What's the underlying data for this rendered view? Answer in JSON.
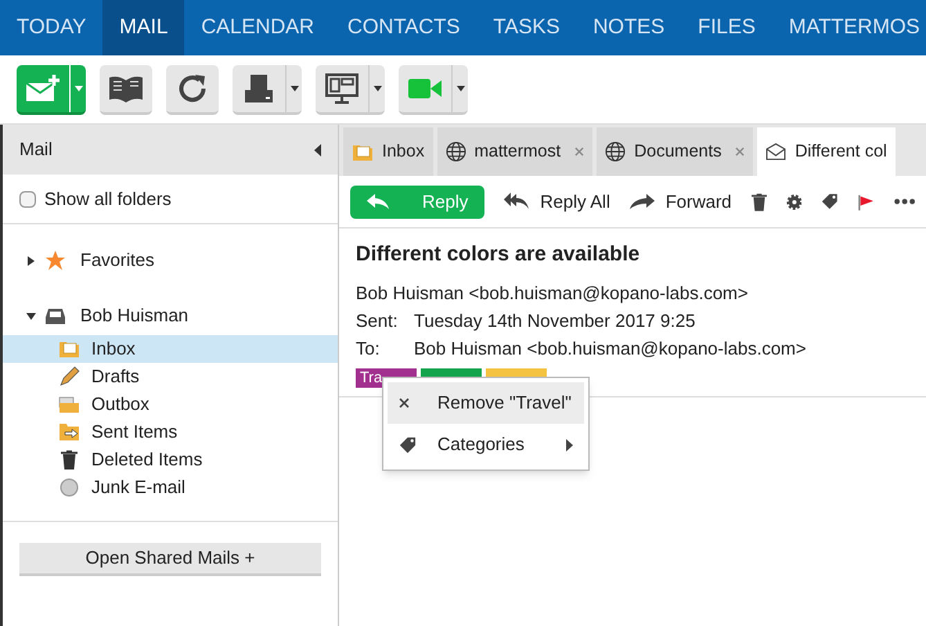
{
  "nav": [
    {
      "label": "TODAY",
      "selected": false
    },
    {
      "label": "MAIL",
      "selected": true
    },
    {
      "label": "CALENDAR",
      "selected": false
    },
    {
      "label": "CONTACTS",
      "selected": false
    },
    {
      "label": "TASKS",
      "selected": false
    },
    {
      "label": "NOTES",
      "selected": false
    },
    {
      "label": "FILES",
      "selected": false
    },
    {
      "label": "MATTERMOS",
      "selected": false
    }
  ],
  "toolbar": [
    {
      "kind": "new-mail",
      "split": true
    },
    {
      "kind": "book",
      "split": false
    },
    {
      "kind": "refresh",
      "split": false
    },
    {
      "kind": "print",
      "split": true
    },
    {
      "kind": "monitor",
      "split": true
    },
    {
      "kind": "video",
      "split": true
    }
  ],
  "sidebar": {
    "title": "Mail",
    "show_all": {
      "label": "Show all folders",
      "checked": false
    },
    "tree": [
      {
        "label": "Favorites",
        "kind": "star",
        "expanded": false
      },
      {
        "label": "Bob Huisman",
        "kind": "store",
        "expanded": true,
        "children": [
          {
            "label": "Inbox",
            "kind": "inbox",
            "selected": true
          },
          {
            "label": "Drafts",
            "kind": "drafts",
            "selected": false
          },
          {
            "label": "Outbox",
            "kind": "outbox",
            "selected": false
          },
          {
            "label": "Sent Items",
            "kind": "sent",
            "selected": false
          },
          {
            "label": "Deleted Items",
            "kind": "deleted",
            "selected": false
          },
          {
            "label": "Junk E-mail",
            "kind": "junk",
            "selected": false
          }
        ]
      }
    ],
    "shared_button": "Open Shared Mails +"
  },
  "tabs": [
    {
      "label": "Inbox",
      "kind": "inbox",
      "closable": false,
      "selected": false
    },
    {
      "label": "mattermost",
      "kind": "web",
      "closable": true,
      "selected": false
    },
    {
      "label": "Documents",
      "kind": "web",
      "closable": true,
      "selected": false
    },
    {
      "label": "Different col",
      "kind": "mail",
      "closable": false,
      "selected": true
    }
  ],
  "actions": [
    {
      "kind": "reply",
      "label": "Reply"
    },
    {
      "kind": "reply-all",
      "label": "Reply All"
    },
    {
      "kind": "forward",
      "label": "Forward"
    },
    {
      "kind": "delete"
    },
    {
      "kind": "gear"
    },
    {
      "kind": "tag"
    },
    {
      "kind": "flag"
    },
    {
      "kind": "more"
    }
  ],
  "message": {
    "subject": "Different colors are available",
    "from": "Bob Huisman <bob.huisman@kopano-labs.com>",
    "sent_label": "Sent:",
    "sent": "Tuesday 14th November 2017 9:25",
    "to_label": "To:",
    "to": "Bob Huisman <bob.huisman@kopano-labs.com>",
    "categories": [
      {
        "label": "Tra",
        "color": "#a2308f"
      },
      {
        "color": "#14a44d"
      },
      {
        "color": "#f5c342"
      }
    ]
  },
  "context_menu": [
    {
      "kind": "remove",
      "label": "Remove \"Travel\"",
      "selected": true
    },
    {
      "kind": "categories",
      "label": "Categories",
      "selected": false
    }
  ]
}
